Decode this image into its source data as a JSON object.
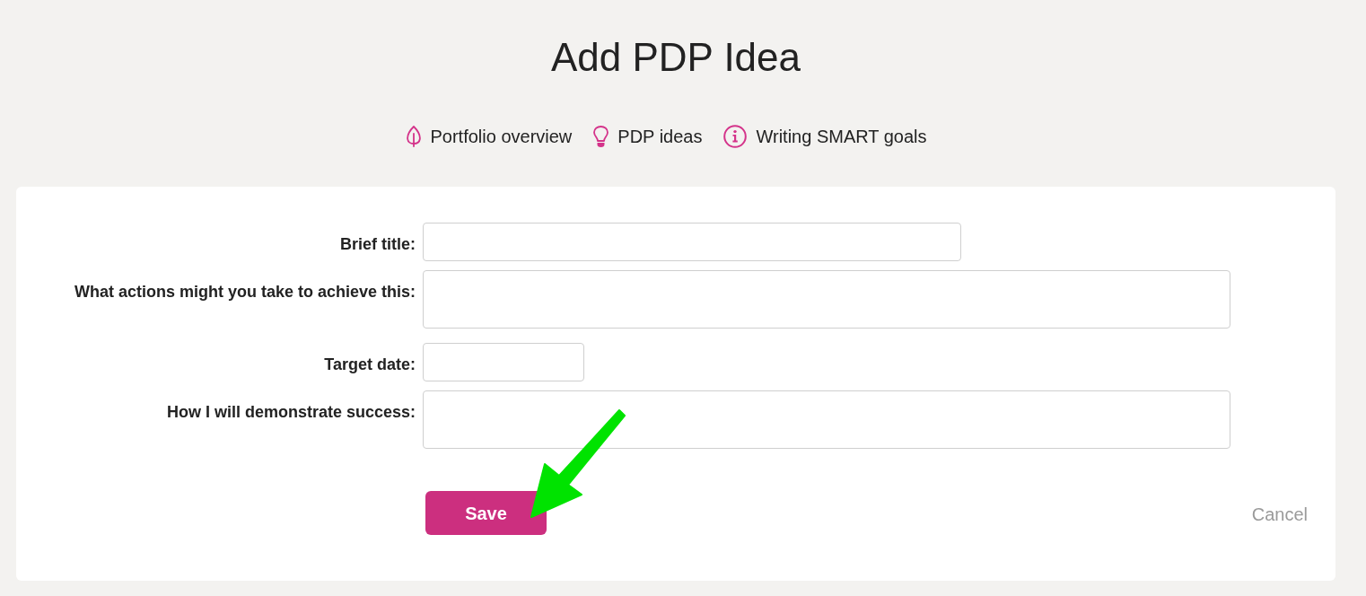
{
  "page": {
    "title": "Add PDP Idea"
  },
  "links": [
    {
      "label": "Portfolio overview",
      "kind": "leaf"
    },
    {
      "label": "PDP ideas",
      "kind": "bulb"
    },
    {
      "label": "Writing SMART goals",
      "kind": "info"
    }
  ],
  "form": {
    "fields": [
      {
        "label": "Brief title:",
        "kind": "text"
      },
      {
        "label": "What actions might you take to achieve this:",
        "kind": "textarea"
      },
      {
        "label": "Target date:",
        "kind": "date"
      },
      {
        "label": "How I will demonstrate success:",
        "kind": "textarea"
      }
    ],
    "actions": [
      {
        "label": "Save",
        "kind": "primary"
      },
      {
        "label": "Cancel",
        "kind": "link"
      }
    ]
  },
  "annotation": {
    "kind": "arrow"
  }
}
